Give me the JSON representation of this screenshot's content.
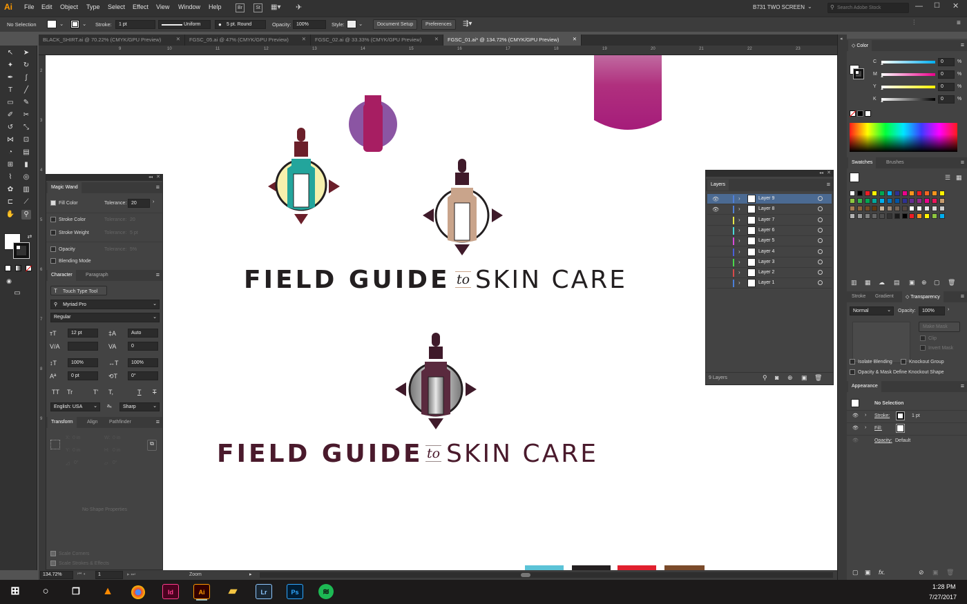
{
  "app": {
    "logo": "Ai",
    "workspace": "B731 TWO SCREEN",
    "search_placeholder": "Search Adobe Stock"
  },
  "menu": [
    "File",
    "Edit",
    "Object",
    "Type",
    "Select",
    "Effect",
    "View",
    "Window",
    "Help"
  ],
  "menu_badges": [
    "Br",
    "St"
  ],
  "control": {
    "selection": "No Selection",
    "stroke_label": "Stroke:",
    "stroke_value": "1 pt",
    "profile": "Uniform",
    "brush": "5 pt. Round",
    "opacity_label": "Opacity:",
    "opacity_value": "100%",
    "style_label": "Style:",
    "doc_setup": "Document Setup",
    "preferences": "Preferences"
  },
  "doc_tabs": [
    {
      "label": "BLACK_SHIRT.ai @ 70.22% (CMYK/GPU Preview)",
      "active": false
    },
    {
      "label": "FGSC_05.ai @ 47% (CMYK/GPU Preview)",
      "active": false
    },
    {
      "label": "FGSC_02.ai @ 33.33% (CMYK/GPU Preview)",
      "active": false
    },
    {
      "label": "FGSC_01.ai* @ 134.72% (CMYK/GPU Preview)",
      "active": true
    }
  ],
  "ruler_top": [
    "9",
    "10",
    "11",
    "12",
    "13",
    "14",
    "15",
    "16",
    "17",
    "18",
    "19",
    "20",
    "21",
    "22",
    "23"
  ],
  "ruler_left": [
    "2",
    "3",
    "4",
    "5",
    "6",
    "7",
    "8",
    "9"
  ],
  "canvas": {
    "logo1": {
      "word1": "FIELD GUIDE",
      "connector": "to",
      "word2": "SKIN CARE",
      "color": "#231f20"
    },
    "logo2": {
      "word1": "FIELD GUIDE",
      "connector": "to",
      "word2": "SKIN CARE",
      "color": "#4a1a2c"
    },
    "color_strip": [
      "#5bc3d7",
      "#231f20",
      "#e0202e",
      "#7a4a2a"
    ]
  },
  "magic_wand": {
    "title": "Magic Wand",
    "fill_color": "Fill Color",
    "tolerance_label": "Tolerance:",
    "tolerance_value": "20",
    "stroke_color": "Stroke Color",
    "stroke_weight": "Stroke Weight",
    "opacity": "Opacity",
    "blending": "Blending Mode",
    "dim_tol_1": "20",
    "dim_tol_2": "5 pt",
    "dim_tol_3": "5%"
  },
  "character": {
    "tabs": [
      "Character",
      "Paragraph"
    ],
    "touch_type": "Touch Type Tool",
    "font": "Myriad Pro",
    "style": "Regular",
    "size": "12 pt",
    "leading": "Auto",
    "kerning": "",
    "tracking": "0",
    "vscale": "100%",
    "hscale": "100%",
    "baseline": "0 pt",
    "rotation": "0°",
    "case_buttons": [
      "TT",
      "Tr",
      "T'",
      "T,",
      "T",
      "T"
    ],
    "language": "English: USA",
    "aa": "Sharp"
  },
  "transform": {
    "tabs": [
      "Transform",
      "Align",
      "Pathfinder"
    ],
    "x": "0 in",
    "y": "0 in",
    "w": "0 in",
    "h": "0 in",
    "angle": "0°",
    "shear": "0°",
    "no_shape": "No Shape Properties",
    "scale_corners": "Scale Corners",
    "scale_strokes": "Scale Strokes & Effects"
  },
  "layers": {
    "title": "Layers",
    "items": [
      "Layer 9",
      "Layer 8",
      "Layer 7",
      "Layer 6",
      "Layer 5",
      "Layer 4",
      "Layer 3",
      "Layer 2",
      "Layer 1"
    ],
    "colors": [
      "#4f7fd9",
      "#4f7fd9",
      "#e8e84a",
      "#4ad9d9",
      "#d94ad9",
      "#4a5fd9",
      "#4ad94a",
      "#d94a4a",
      "#4a7fd9"
    ],
    "count": "9 Layers"
  },
  "color_panel": {
    "title": "Color",
    "channels": [
      {
        "name": "C",
        "value": "0"
      },
      {
        "name": "M",
        "value": "0"
      },
      {
        "name": "Y",
        "value": "0"
      },
      {
        "name": "K",
        "value": "0"
      }
    ]
  },
  "swatches_tabs": [
    "Swatches",
    "Brushes"
  ],
  "transparency": {
    "tabs": [
      "Stroke",
      "Gradient",
      "Transparency"
    ],
    "mode": "Normal",
    "opacity_label": "Opacity:",
    "opacity_value": "100%",
    "make_mask": "Make Mask",
    "clip": "Clip",
    "invert": "Invert Mask",
    "isolate": "Isolate Blending",
    "knockout": "Knockout Group",
    "opacity_mask": "Opacity & Mask Define Knockout Shape"
  },
  "appearance": {
    "title": "Appearance",
    "selection": "No Selection",
    "stroke_label": "Stroke:",
    "stroke_value": "1 pt",
    "fill_label": "Fill:",
    "opacity_label": "Opacity:",
    "opacity_value": "Default"
  },
  "status": {
    "zoom": "134.72%",
    "artboard": "1",
    "tool": "Zoom"
  },
  "taskbar": {
    "time": "1:28 PM",
    "date": "7/27/2017"
  }
}
